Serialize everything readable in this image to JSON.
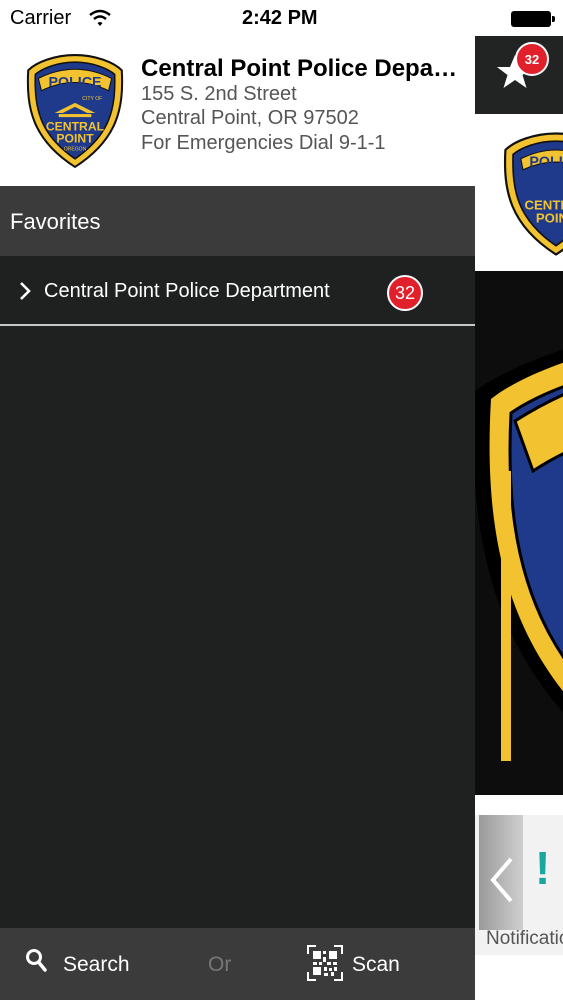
{
  "status_bar": {
    "carrier": "Carrier",
    "time": "2:42 PM"
  },
  "header": {
    "logo_text": "POLICE",
    "logo_city_text": "CITY OF",
    "logo_name_line1": "CENTRAL",
    "logo_name_line2": "POINT",
    "logo_state_text": "OREGON",
    "department_name": "Central Point Police Department",
    "address_line1": "155 S. 2nd Street",
    "address_line2": "Central Point, OR 97502",
    "emergency_text": "For Emergencies Dial 9-1-1"
  },
  "favorites": {
    "title": "Favorites",
    "items": [
      {
        "label": "Central Point Police Department",
        "badge": "32"
      }
    ]
  },
  "bottom_bar": {
    "search_label": "Search",
    "or_label": "Or",
    "scan_label": "Scan"
  },
  "right_panel": {
    "favorites_badge": "32",
    "notification_label": "Notifications",
    "notification_icon": "!"
  },
  "icons": {
    "wifi": "wifi-icon",
    "chevron": "chevron-right-icon",
    "search": "search-icon",
    "scan": "qr-code-icon",
    "favorites": "star-icon",
    "back": "chevron-left-icon",
    "notification": "exclamation-icon"
  },
  "colors": {
    "drawer_bg": "#1f2120",
    "section_bg": "#3a3b3a",
    "badge_red": "#e0202a",
    "badge_blue": "#1f3a8a",
    "badge_gold": "#f2c230",
    "notification_teal": "#1aa7a1"
  }
}
